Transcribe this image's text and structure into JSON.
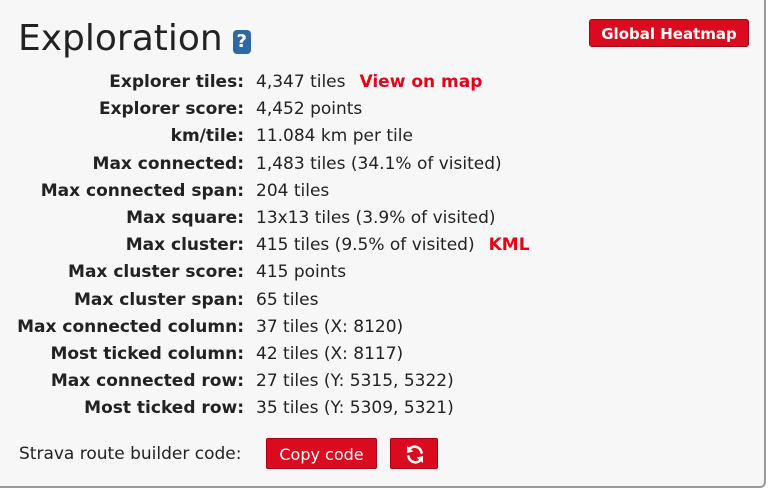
{
  "header": {
    "title": "Exploration",
    "help_label": "?",
    "heatmap_button": "Global Heatmap"
  },
  "stats": [
    {
      "label": "Explorer tiles:",
      "value": "4,347 tiles",
      "link": "View on map"
    },
    {
      "label": "Explorer score:",
      "value": "4,452 points"
    },
    {
      "label": "km/tile:",
      "value": "11.084 km per tile"
    },
    {
      "label": "Max connected:",
      "value": "1,483 tiles (34.1% of visited)"
    },
    {
      "label": "Max connected span:",
      "value": "204 tiles"
    },
    {
      "label": "Max square:",
      "value": "13x13 tiles (3.9% of visited)"
    },
    {
      "label": "Max cluster:",
      "value": "415 tiles (9.5% of visited)",
      "link": "KML"
    },
    {
      "label": "Max cluster score:",
      "value": "415 points"
    },
    {
      "label": "Max cluster span:",
      "value": "65 tiles"
    },
    {
      "label": "Max connected column:",
      "value": "37 tiles (X: 8120)"
    },
    {
      "label": "Most ticked column:",
      "value": "42 tiles (X: 8117)"
    },
    {
      "label": "Max connected row:",
      "value": "27 tiles (Y: 5315, 5322)"
    },
    {
      "label": "Most ticked row:",
      "value": "35 tiles (Y: 5309, 5321)"
    }
  ],
  "route_builder": {
    "label": "Strava route builder code:",
    "copy_button": "Copy code",
    "refresh_icon": "refresh-icon"
  },
  "colors": {
    "accent": "#dc0a1e",
    "link": "#e60017",
    "help_badge": "#2e6aa1",
    "panel_background": "#f7f7f7"
  }
}
